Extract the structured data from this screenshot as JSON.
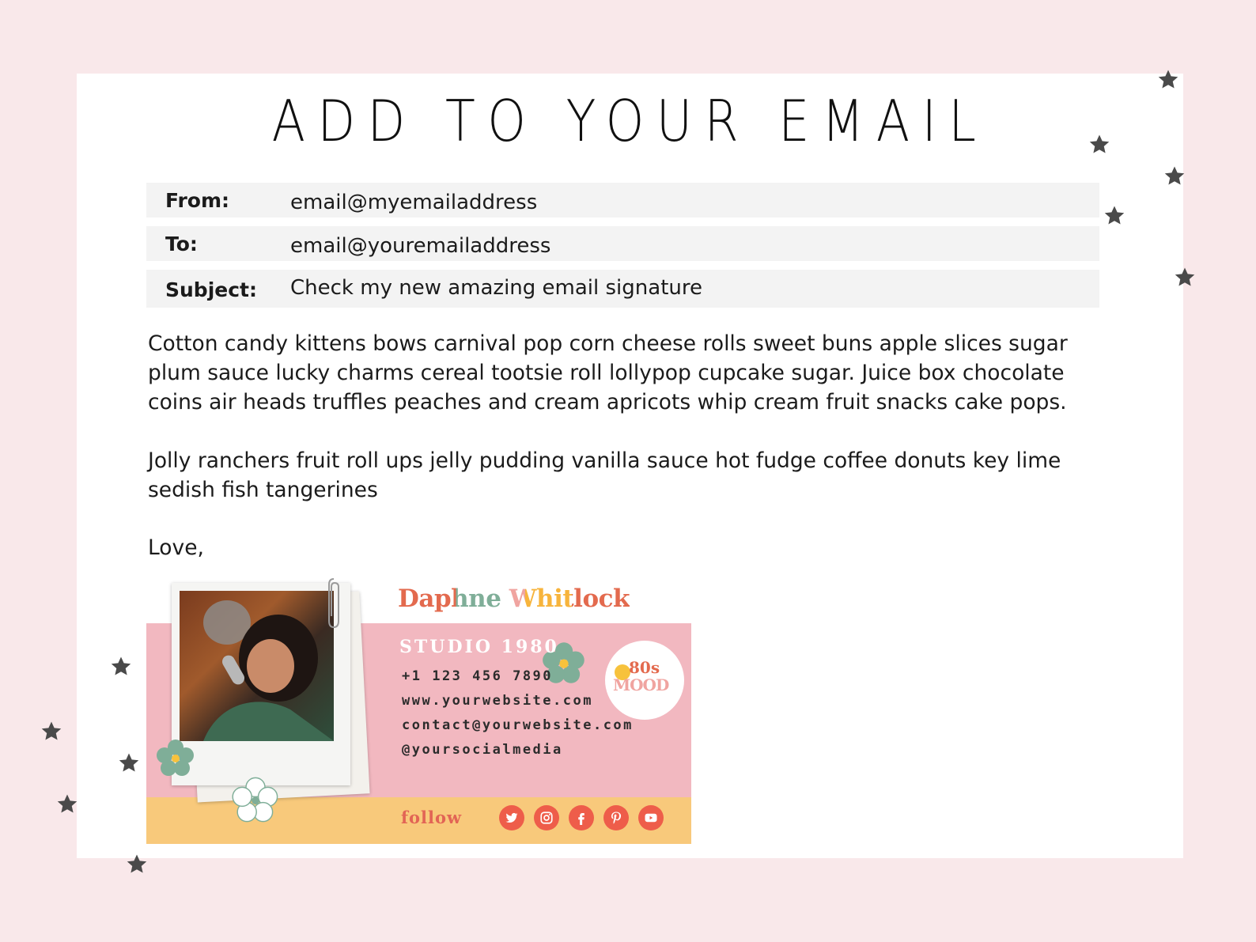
{
  "title": "ADD TO YOUR EMAIL",
  "email_header": {
    "from_label": "From:",
    "from_value": "email@myemailaddress",
    "to_label": "To:",
    "to_value": "email@youremailaddress",
    "subject_label": "Subject:",
    "subject_value": "Check my new amazing email signature"
  },
  "body": {
    "paragraph1": "Cotton candy kittens bows carnival pop corn cheese rolls sweet buns apple slices sugar plum sauce lucky charms cereal tootsie roll lollypop cupcake sugar. Juice box chocolate coins air heads truffles peaches and cream apricots whip cream fruit snacks cake pops.",
    "paragraph2": "Jolly ranchers fruit roll ups jelly pudding vanilla sauce hot fudge coffee donuts key lime sedish fish tangerines",
    "closing": "Love,"
  },
  "signature": {
    "name": "Daphne Whitlock",
    "studio": "STUDIO 1980",
    "phone": "+1 123 456 7890",
    "website": "www.yourwebsite.com",
    "email": "contact@yourwebsite.com",
    "social_handle": "@yoursocialmedia",
    "follow_label": "follow",
    "badge_top": "80s",
    "badge_bottom": "MOOD",
    "social_icons": [
      "twitter-icon",
      "instagram-icon",
      "facebook-icon",
      "pinterest-icon",
      "youtube-icon"
    ]
  },
  "colors": {
    "background": "#f9e8ea",
    "card": "#ffffff",
    "header_row": "#f3f3f3",
    "signature_pink": "#f2b8c0",
    "signature_yellow": "#f8c97b",
    "accent_red": "#ee5d4a",
    "star": "#4a4a4a"
  }
}
